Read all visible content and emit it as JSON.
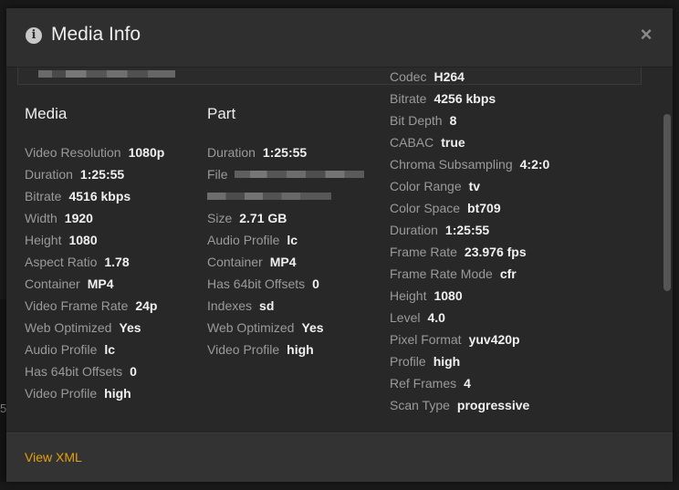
{
  "modal": {
    "title": "Media Info",
    "close_glyph": "×",
    "info_glyph": "i"
  },
  "background": {
    "edge_glyph": "5,"
  },
  "media": {
    "title": "Media",
    "rows": [
      {
        "k": "Video Resolution",
        "v": "1080p"
      },
      {
        "k": "Duration",
        "v": "1:25:55"
      },
      {
        "k": "Bitrate",
        "v": "4516 kbps"
      },
      {
        "k": "Width",
        "v": "1920"
      },
      {
        "k": "Height",
        "v": "1080"
      },
      {
        "k": "Aspect Ratio",
        "v": "1.78"
      },
      {
        "k": "Container",
        "v": "MP4"
      },
      {
        "k": "Video Frame Rate",
        "v": "24p"
      },
      {
        "k": "Web Optimized",
        "v": "Yes"
      },
      {
        "k": "Audio Profile",
        "v": "lc"
      },
      {
        "k": "Has 64bit Offsets",
        "v": "0"
      },
      {
        "k": "Video Profile",
        "v": "high"
      }
    ]
  },
  "part": {
    "title": "Part",
    "duration": {
      "k": "Duration",
      "v": "1:25:55"
    },
    "file": {
      "k": "File"
    },
    "rows": [
      {
        "k": "Size",
        "v": "2.71 GB"
      },
      {
        "k": "Audio Profile",
        "v": "lc"
      },
      {
        "k": "Container",
        "v": "MP4"
      },
      {
        "k": "Has 64bit Offsets",
        "v": "0"
      },
      {
        "k": "Indexes",
        "v": "sd"
      },
      {
        "k": "Web Optimized",
        "v": "Yes"
      },
      {
        "k": "Video Profile",
        "v": "high"
      }
    ]
  },
  "stream": {
    "rows": [
      {
        "k": "Codec",
        "v": "H264"
      },
      {
        "k": "Bitrate",
        "v": "4256 kbps"
      },
      {
        "k": "Bit Depth",
        "v": "8"
      },
      {
        "k": "CABAC",
        "v": "true"
      },
      {
        "k": "Chroma Subsampling",
        "v": "4:2:0"
      },
      {
        "k": "Color Range",
        "v": "tv"
      },
      {
        "k": "Color Space",
        "v": "bt709"
      },
      {
        "k": "Duration",
        "v": "1:25:55"
      },
      {
        "k": "Frame Rate",
        "v": "23.976 fps"
      },
      {
        "k": "Frame Rate Mode",
        "v": "cfr"
      },
      {
        "k": "Height",
        "v": "1080"
      },
      {
        "k": "Level",
        "v": "4.0"
      },
      {
        "k": "Pixel Format",
        "v": "yuv420p"
      },
      {
        "k": "Profile",
        "v": "high"
      },
      {
        "k": "Ref Frames",
        "v": "4"
      },
      {
        "k": "Scan Type",
        "v": "progressive"
      }
    ]
  },
  "footer": {
    "view_xml_label": "View XML"
  },
  "colors": {
    "accent": "#e5a00d",
    "modal_bg": "#282828",
    "header_bg": "#2f2f2f",
    "footer_bg": "#333333"
  }
}
